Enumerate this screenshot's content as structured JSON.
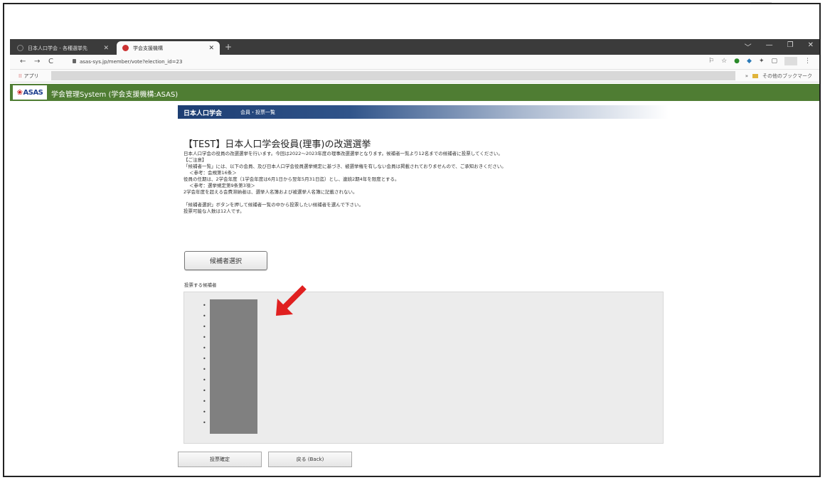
{
  "browser": {
    "tabs": [
      {
        "label": "日本人口学会 - 各種選挙先",
        "active": false
      },
      {
        "label": "学会支援機構",
        "active": true
      }
    ],
    "new_tab": "+",
    "window_controls": [
      "﹀",
      "—",
      "❐",
      "✕"
    ],
    "nav": {
      "back": "←",
      "forward": "→",
      "reload": "C"
    },
    "url": "asas-sys.jp/member/vote?election_id=23",
    "bookmarks": {
      "apps": "アプリ",
      "other": "その他のブックマーク"
    }
  },
  "site": {
    "logo": "ASAS",
    "title": "学会管理System (学会支援機構:ASAS)"
  },
  "section": {
    "society": "日本人口学会",
    "subtitle": "会員・投票一覧"
  },
  "election": {
    "title": "【TEST】日本人口学会役員(理事)の改選選挙",
    "desc_lines": [
      "日本人口学会の役員の改選選挙を行います。今回は2022〜2023年度の理事改選選挙となります。候補者一覧より12名までの候補者に投票してください。",
      "【ご注意】",
      "「候補者一覧」には、以下の会員、及び日本人口学会役員選挙規定に基づき、被選挙権を有しない会員は掲載されておりませんので、ご承知おきください。",
      "＜参考：会規第16条＞",
      "役員の任期は、2学会年度（1学会年度は6月1日から翌年5月31日迄）とし、連続2期4年を限度とする。",
      "＜参考：選挙規定第9条第3項＞",
      "2学会年度を超える会費滞納者は、選挙人名簿および被選挙人名簿に記載されない。",
      "「候補者選択」ボタンを押して候補者一覧の中から投票したい候補者を選んで下さい。",
      "投票可能な人数は12人です。"
    ],
    "select_button": "候補者選択",
    "candidates_label": "投票する候補者",
    "bullet_count": 12,
    "confirm_button": "投票確定",
    "back_button": "戻る (Back)"
  },
  "colors": {
    "header_green": "#4f7d33",
    "section_blue": "#1d3e73",
    "arrow_red": "#e02020",
    "redaction_gray": "#808080"
  }
}
